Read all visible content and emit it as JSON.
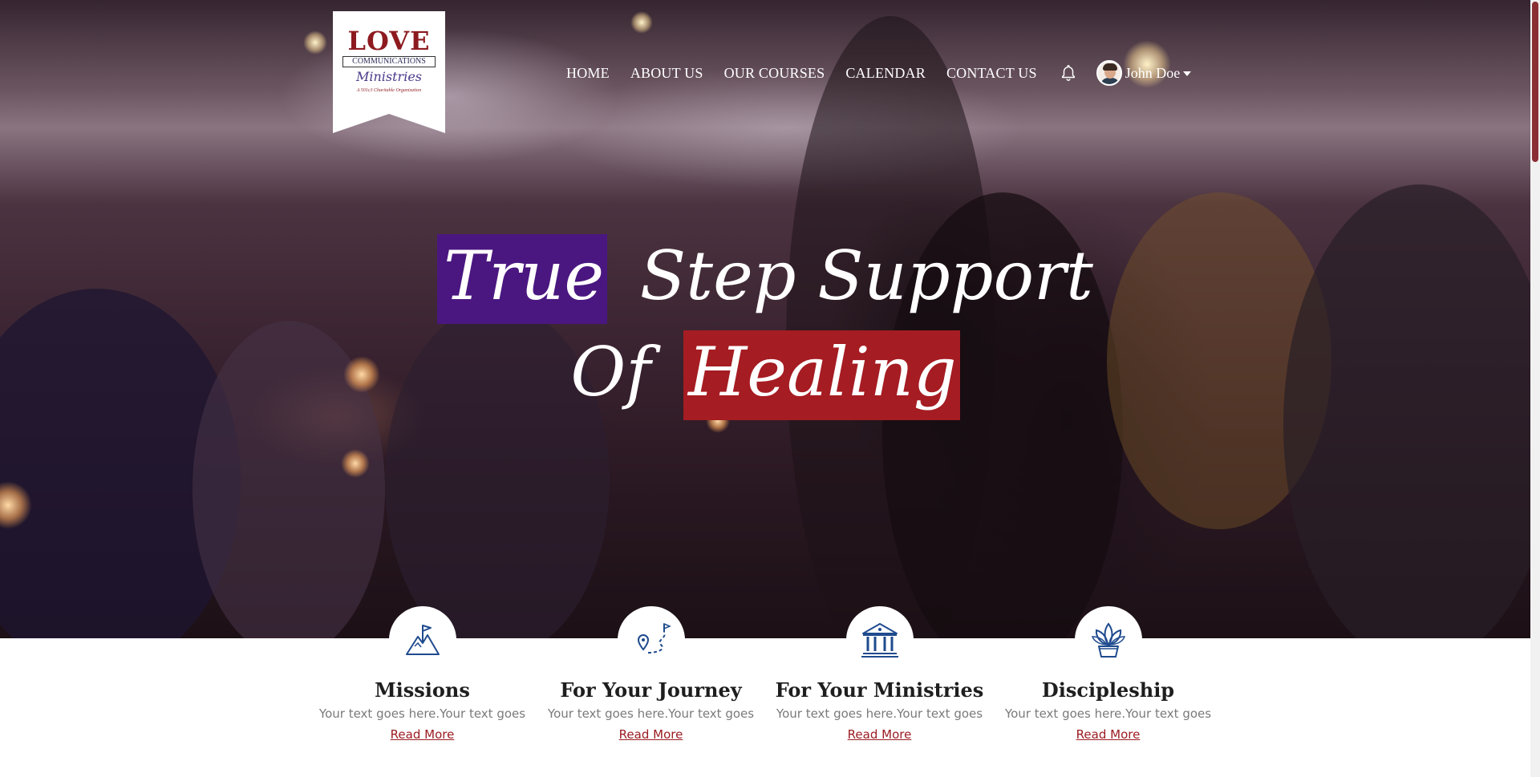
{
  "logo": {
    "love": "LOVE",
    "communications": "COMMUNICATIONS",
    "ministries": "Ministries",
    "tagline": "A 501c3 Charitable Organization"
  },
  "nav": {
    "items": [
      {
        "label": "HOME"
      },
      {
        "label": "ABOUT US"
      },
      {
        "label": "OUR COURSES"
      },
      {
        "label": "CALENDAR"
      },
      {
        "label": "CONTACT US"
      }
    ],
    "bell_icon": "bell-icon",
    "user": {
      "name": "John Doe"
    }
  },
  "hero": {
    "headline": {
      "word1": "True",
      "word2": "Step Support",
      "word3": "Of",
      "word4": "Healing"
    },
    "colors": {
      "purple": "#4a1780",
      "red": "#a51c22"
    }
  },
  "features": [
    {
      "icon": "mountain-flag-icon",
      "title": "Missions",
      "text": "Your text goes here.Your text goes",
      "link": "Read More"
    },
    {
      "icon": "journey-path-icon",
      "title": "For Your Journey",
      "text": "Your text goes here.Your text goes",
      "link": "Read More"
    },
    {
      "icon": "building-columns-icon",
      "title": "For Your Ministries",
      "text": "Your text goes here.Your text goes",
      "link": "Read More"
    },
    {
      "icon": "plant-icon",
      "title": "Discipleship",
      "text": "Your text goes here.Your text goes",
      "link": "Read More"
    }
  ],
  "colors": {
    "accent": "#9b1c22",
    "icon": "#1f4b8e"
  }
}
